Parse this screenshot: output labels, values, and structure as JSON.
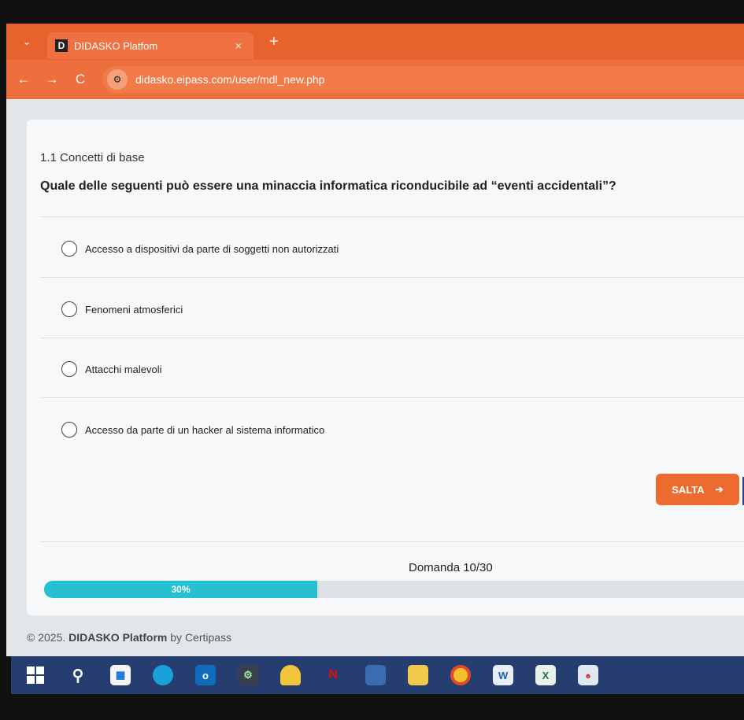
{
  "browser": {
    "tab_title": "DIDASKO Platfom",
    "tab_favicon": "D",
    "close_glyph": "×",
    "new_tab_glyph": "+",
    "url": "didasko.eipass.com/user/mdl_new.php",
    "back_glyph": "←",
    "forward_glyph": "→",
    "reload_glyph": "C",
    "dropdown_glyph": "⌄",
    "site_info_glyph": "⚙",
    "accent_color": "#e8622e"
  },
  "quiz": {
    "section": "1.1 Concetti di base",
    "question": "Quale delle seguenti può essere una minaccia informatica riconducibile ad “eventi accidentali”?",
    "options": [
      "Accesso a dispositivi da parte di soggetti non autorizzati",
      "Fenomeni atmosferici",
      "Attacchi malevoli",
      "Accesso da parte di un hacker al sistema informatico"
    ],
    "skip_label": "SALTA",
    "skip_arrow": "➔",
    "counter": "Domanda 10/30",
    "progress_label": "30%",
    "progress": 0.3
  },
  "footer": {
    "copyright": "© 2025.",
    "brand": "DIDASKO Platform",
    "by": "by Certipass"
  },
  "taskbar": {
    "icons": [
      "windows-start-icon",
      "search-icon",
      "store-icon",
      "edge-icon",
      "outlook-icon",
      "teams-icon",
      "weather-icon",
      "netflix-icon",
      "app-icon",
      "file-explorer-icon",
      "chrome-icon",
      "word-icon",
      "excel-icon",
      "image-app-icon"
    ]
  }
}
